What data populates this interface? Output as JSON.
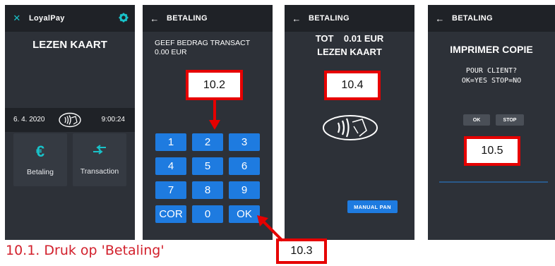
{
  "screen1": {
    "app_title": "LoyalPay",
    "heading": "LEZEN KAART",
    "date": "6. 4. 2020",
    "time": "9:00:24",
    "tiles": [
      {
        "label": "Betaling",
        "icon": "euro-icon"
      },
      {
        "label": "Transaction",
        "icon": "arrows-icon"
      }
    ]
  },
  "screen2": {
    "title": "BETALING",
    "prompt_line1": "GEEF BEDRAG TRANSACT",
    "prompt_line2": "0.00 EUR",
    "keys": [
      "1",
      "2",
      "3",
      "4",
      "5",
      "6",
      "7",
      "8",
      "9",
      "COR",
      "0",
      "OK"
    ]
  },
  "screen3": {
    "title": "BETALING",
    "line1": "TOT    0.01 EUR",
    "line2": "LEZEN KAART",
    "manual_button": "MANUAL PAN"
  },
  "screen4": {
    "title": "BETALING",
    "heading": "IMPRIMER COPIE",
    "line1": "POUR CLIENT?",
    "line2": "OK=YES STOP=NO",
    "ok_button": "OK",
    "stop_button": "STOP"
  },
  "callouts": {
    "c102": "10.2",
    "c103": "10.3",
    "c104": "10.4",
    "c105": "10.5"
  },
  "caption": "10.1. Druk op 'Betaling'",
  "colors": {
    "accent_cyan": "#19c2c9",
    "key_blue": "#1e7be0",
    "callout_red": "#e60000",
    "screen_bg": "#2d3138"
  }
}
